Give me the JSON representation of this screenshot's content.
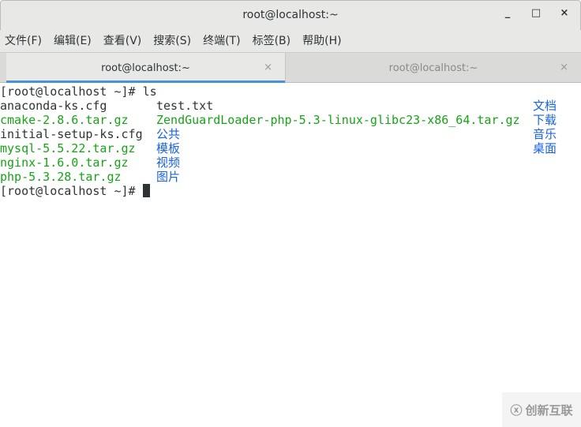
{
  "window": {
    "title": "root@localhost:~",
    "minimize": "_",
    "maximize": "□",
    "close": "×"
  },
  "menu": [
    "文件(F)",
    "编辑(E)",
    "查看(V)",
    "搜索(S)",
    "终端(T)",
    "标签(B)",
    "帮助(H)"
  ],
  "tabs": [
    {
      "label": "root@localhost:~",
      "close": "×",
      "active": true
    },
    {
      "label": "root@localhost:~",
      "close": "×",
      "active": false
    }
  ],
  "terminal": {
    "prompt1": "[root@localhost ~]# ls",
    "rows": [
      [
        {
          "t": "anaconda-ks.cfg",
          "c": "k"
        },
        {
          "t": "test.txt",
          "c": "k"
        },
        {
          "t": "文档",
          "c": "b"
        }
      ],
      [
        {
          "t": "cmake-2.8.6.tar.gz",
          "c": "g"
        },
        {
          "t": "ZendGuardLoader-php-5.3-linux-glibc23-x86_64.tar.gz",
          "c": "g"
        },
        {
          "t": "下载",
          "c": "b"
        }
      ],
      [
        {
          "t": "initial-setup-ks.cfg",
          "c": "k"
        },
        {
          "t": "公共",
          "c": "b"
        },
        {
          "t": "音乐",
          "c": "b"
        }
      ],
      [
        {
          "t": "mysql-5.5.22.tar.gz",
          "c": "g"
        },
        {
          "t": "模板",
          "c": "b"
        },
        {
          "t": "桌面",
          "c": "b"
        }
      ],
      [
        {
          "t": "nginx-1.6.0.tar.gz",
          "c": "g"
        },
        {
          "t": "视频",
          "c": "b"
        }
      ],
      [
        {
          "t": "php-5.3.28.tar.gz",
          "c": "g"
        },
        {
          "t": "图片",
          "c": "b"
        }
      ]
    ],
    "prompt2": "[root@localhost ~]# "
  },
  "watermark": {
    "text": "创新互联",
    "icon": "logo-icon"
  }
}
